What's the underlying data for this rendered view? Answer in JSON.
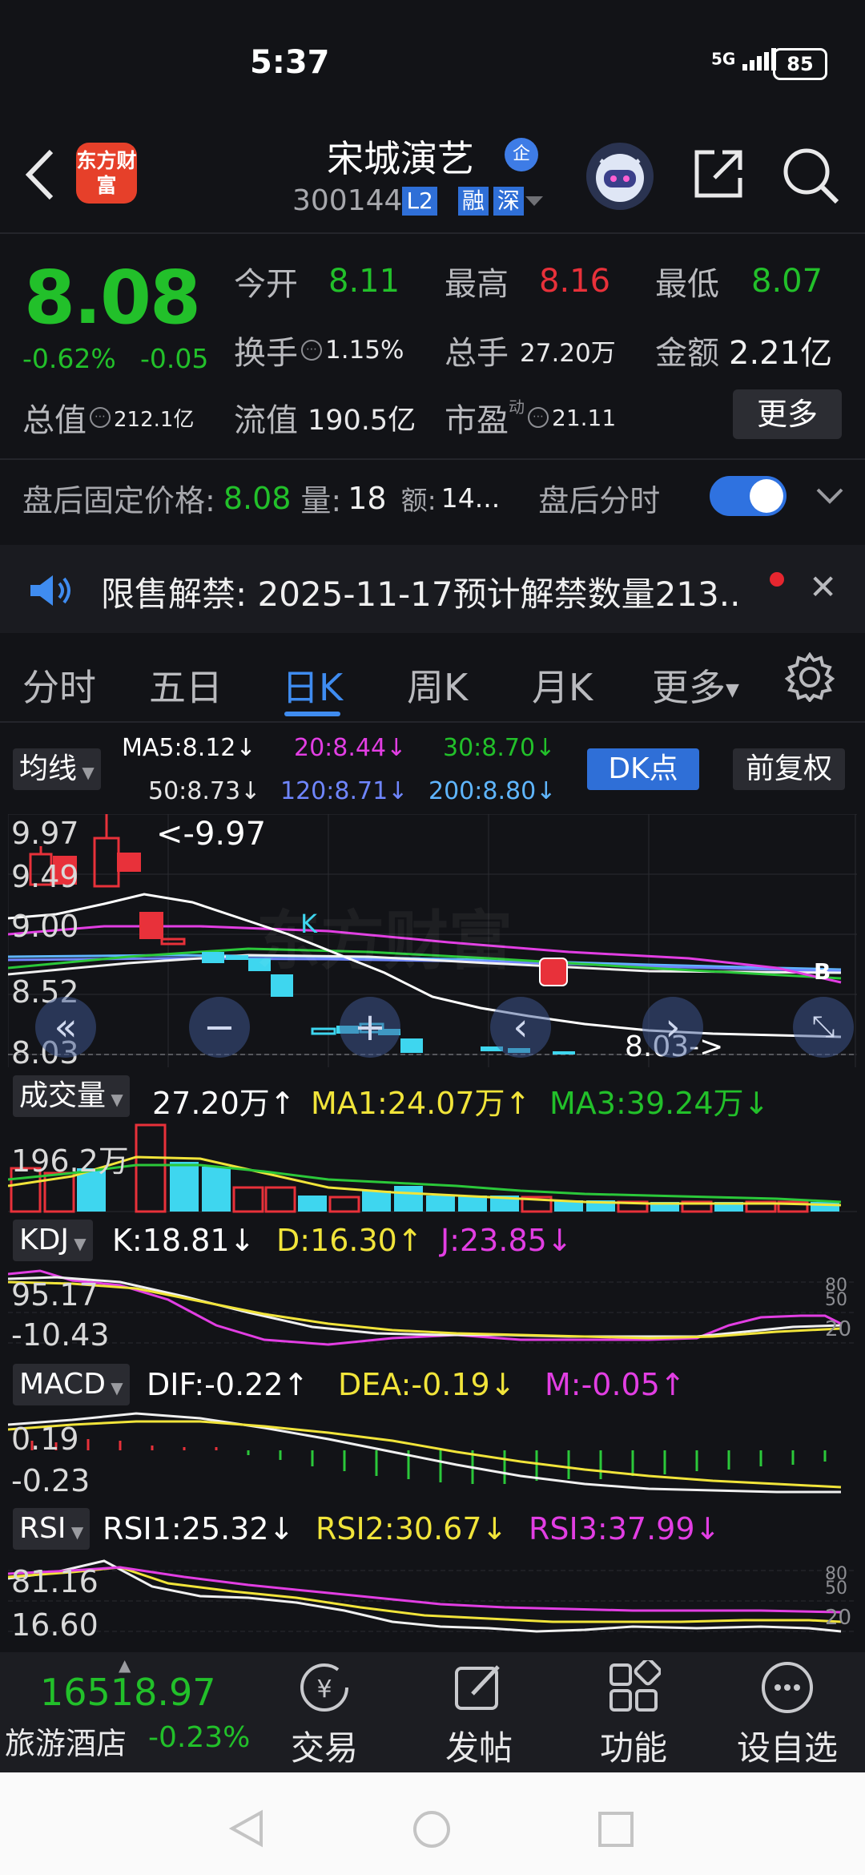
{
  "status_bar": {
    "time": "5:37",
    "network": "5G",
    "battery": "85"
  },
  "header": {
    "logo_text": "东方财富",
    "stock_name": "宋城演艺",
    "badge": "企",
    "stock_code": "300144",
    "level_tag": "L2",
    "market_tags": [
      "融",
      "深"
    ]
  },
  "quote": {
    "price": "8.08",
    "change_pct": "-0.62%",
    "change": "-0.05",
    "open_label": "今开",
    "open": "8.11",
    "high_label": "最高",
    "high": "8.16",
    "low_label": "最低",
    "low": "8.07",
    "turnover_label": "换手",
    "turnover": "1.15%",
    "volume_label": "总手",
    "volume": "27.20万",
    "amount_label": "金额",
    "amount": "2.21亿",
    "mktcap_label": "总值",
    "mktcap": "212.1亿",
    "float_label": "流值",
    "float_cap": "190.5亿",
    "pe_label": "市盈",
    "pe_sup": "动",
    "pe": "21.11",
    "more_button": "更多"
  },
  "after_hours": {
    "label": "盘后固定价格:",
    "price": "8.08",
    "vol_label": "量:",
    "vol": "18",
    "amt_label": "额:",
    "amt": "14...",
    "timeshare_label": "盘后分时",
    "timeshare_on": true
  },
  "notice": {
    "text": "限售解禁:  2025-11-17预计解禁数量213.."
  },
  "tabs": [
    "分时",
    "五日",
    "日K",
    "周K",
    "月K",
    "更多"
  ],
  "active_tab": "日K",
  "kline": {
    "ma_selector": "均线",
    "ma5": "MA5:8.12↓",
    "ma20": "20:8.44↓",
    "ma30": "30:8.70↓",
    "ma50": "50:8.73↓",
    "ma120": "120:8.71↓",
    "ma200": "200:8.80↓",
    "dk_button": "DK点",
    "adjust_button": "前复权",
    "axis_labels": [
      "9.97",
      "9.49",
      "9.00",
      "8.52",
      "8.03"
    ],
    "high_marker": "<-9.97",
    "low_marker": "8.03->",
    "k_marker": "K",
    "b_marker": "B"
  },
  "volume": {
    "selector": "成交量",
    "value": "27.20万↑",
    "ma1": "MA1:24.07万↑",
    "ma3": "MA3:39.24万↓",
    "axis_label": "196.2万"
  },
  "kdj": {
    "selector": "KDJ",
    "k": "K:18.81↓",
    "d": "D:16.30↑",
    "j": "J:23.85↓",
    "axis_top": "95.17",
    "axis_bottom": "-10.43",
    "right_labels": [
      "80",
      "50",
      "20"
    ]
  },
  "macd": {
    "selector": "MACD",
    "dif": "DIF:-0.22↑",
    "dea": "DEA:-0.19↓",
    "m": "M:-0.05↑",
    "axis_top": "0.19",
    "axis_bottom": "-0.23"
  },
  "rsi": {
    "selector": "RSI",
    "rsi1": "RSI1:25.32↓",
    "rsi2": "RSI2:30.67↓",
    "rsi3": "RSI3:37.99↓",
    "axis_top": "81.16",
    "axis_bottom": "16.60",
    "right_labels": [
      "80",
      "50",
      "20"
    ]
  },
  "bottom_bar": {
    "index_value": "16518.97",
    "index_name": "旅游酒店",
    "index_pct": "-0.23%",
    "nav": [
      "交易",
      "发帖",
      "功能",
      "设自选"
    ]
  },
  "colors": {
    "up": "#e8313a",
    "down": "#22c02a",
    "accent": "#3f8cf0",
    "cyan": "#3ed6ef",
    "yellow": "#f1e43a",
    "magenta": "#e23ee3"
  }
}
